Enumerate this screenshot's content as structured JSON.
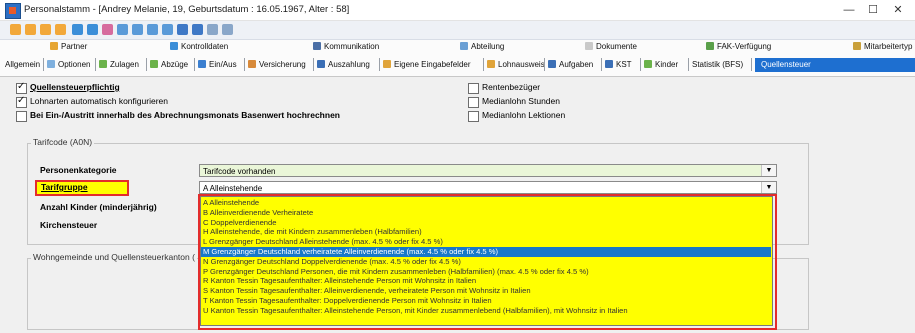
{
  "window": {
    "title": "Personalstamm - [Andrey Melanie, 19, Geburtsdatum : 16.05.1967, Alter : 58]",
    "minimize_glyph": "—",
    "maximize_glyph": "☐",
    "close_glyph": "✕"
  },
  "toolbar": {
    "icons": [
      "nav-first-icon",
      "nav-prev-icon",
      "nav-next-icon",
      "nav-last-icon",
      "sort-icon",
      "filter-icon",
      "edit-icon",
      "list-icon",
      "grid-icon",
      "tree-icon",
      "calendar-icon",
      "save-icon",
      "print-icon",
      "copy-icon",
      "search-icon"
    ]
  },
  "tabs_top": [
    "Partner",
    "Kontrolldaten",
    "Kommunikation",
    "Abteilung",
    "Dokumente",
    "FAK-Verfügung",
    "Mitarbeitertyp"
  ],
  "tabs_bottom": [
    "Allgemein",
    "Optionen",
    "Zulagen",
    "Abzüge",
    "Ein/Aus",
    "Versicherung",
    "Auszahlung",
    "Eigene Eingabefelder",
    "Lohnausweis",
    "Aufgaben",
    "KST",
    "Kinder",
    "Statistik (BFS)",
    "Quellensteuer"
  ],
  "checkboxes": {
    "quellensteuerpflichtig": "Quellensteuerpflichtig",
    "lohnarten_auto": "Lohnarten automatisch konfigurieren",
    "basenwert": "Bei Ein-/Austritt innerhalb des Abrechnungsmonats Basenwert hochrechnen",
    "rentenbezueger": "Rentenbezüger",
    "medianlohn_stunden": "Medianlohn Stunden",
    "medianlohn_lektionen": "Medianlohn Lektionen"
  },
  "tarifcode_group": {
    "label": "Tarifcode (A0N)",
    "personenkategorie_label": "Personenkategorie",
    "personenkategorie_value": "Tarifcode vorhanden",
    "tarifgruppe_label": "Tarifgruppe",
    "tarifgruppe_value": "A Alleinstehende",
    "anzahl_kinder_label": "Anzahl Kinder (minderjährig)",
    "kirchensteuer_label": "Kirchensteuer"
  },
  "wohngemeinde_group": {
    "label": "Wohngemeinde und Quellensteuerkanton ("
  },
  "tarifgruppe_options": [
    "A Alleinstehende",
    "B Alleinverdienende Verheiratete",
    "C Doppelverdienende",
    "H Alleinstehende, die mit Kindern zusammenleben (Halbfamilien)",
    "L Grenzgänger Deutschland Alleinstehende (max. 4.5 % oder fix 4.5 %)",
    "M Grenzgänger Deutschland verheiratete Alleinverdienende (max. 4.5 % oder fix 4.5 %)",
    "N Grenzgänger Deutschland Doppelverdienende (max. 4.5 % oder fix 4.5 %)",
    "P Grenzgänger Deutschland Personen, die mit Kindern zusammenleben (Halbfamilien) (max. 4.5 % oder fix 4.5 %)",
    "R Kanton Tessin Tagesaufenthalter: Alleinstehende Person mit Wohnsitz in Italien",
    "S Kanton Tessin Tagesaufenthalter: Alleinverdienende, verheiratete Person mit Wohnsitz in Italien",
    "T Kanton Tessin Tagesaufenthalter: Doppelverdienende Person mit Wohnsitz in Italien",
    "U Kanton Tessin Tagesaufenthalter: Alleinstehende Person, mit Kinder zusammenlebend (Halbfamilien), mit Wohnsitz in Italien"
  ],
  "highlight_colors": {
    "dropdown_background": "#ffff00",
    "highlight_border": "#e32c2c",
    "selected_option": "#1878c9",
    "active_tab": "#1e6fd0"
  }
}
